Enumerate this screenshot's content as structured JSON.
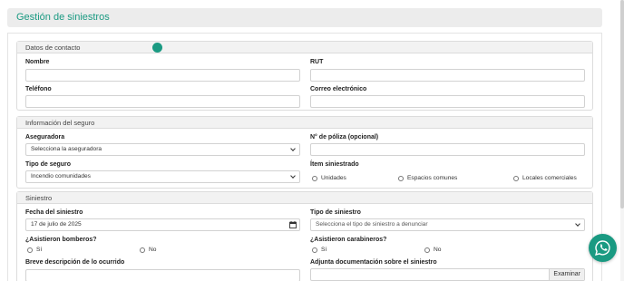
{
  "page": {
    "title": "Gestión de siniestros"
  },
  "contact": {
    "heading": "Datos de contacto",
    "name_label": "Nombre",
    "rut_label": "RUT",
    "phone_label": "Teléfono",
    "email_label": "Correo electrónico"
  },
  "insurance": {
    "heading": "Información del seguro",
    "insurer_label": "Aseguradora",
    "insurer_value": "Selecciona la aseguradora",
    "policy_label": "N° de póliza (opcional)",
    "type_label": "Tipo de seguro",
    "type_value": "Incendio comunidades",
    "item_label": "Ítem siniestrado",
    "item_options": [
      "Unidades",
      "Espacios comunes",
      "Locales comerciales"
    ]
  },
  "claim": {
    "heading": "Siniestro",
    "date_label": "Fecha del siniestro",
    "date_value": "17 de julio de 2025",
    "claim_type_label": "Tipo de siniestro",
    "claim_type_placeholder": "Selecciona el tipo de siniestro a denunciar",
    "firefighters_label": "¿Asistieron bomberos?",
    "police_label": "¿Asistieron carabineros?",
    "yes": "Sí",
    "no": "No",
    "description_label": "Breve descripción de lo ocurrido",
    "attach_label": "Adjunta documentación sobre el siniestro",
    "browse_label": "Examinar"
  },
  "icons": {
    "calendar": "calendar-icon",
    "whatsapp": "whatsapp-icon",
    "status_dot": "status-dot"
  },
  "colors": {
    "accent": "#1a9a82",
    "section_bg": "#f2f2f2",
    "header_bg": "#ececec"
  }
}
